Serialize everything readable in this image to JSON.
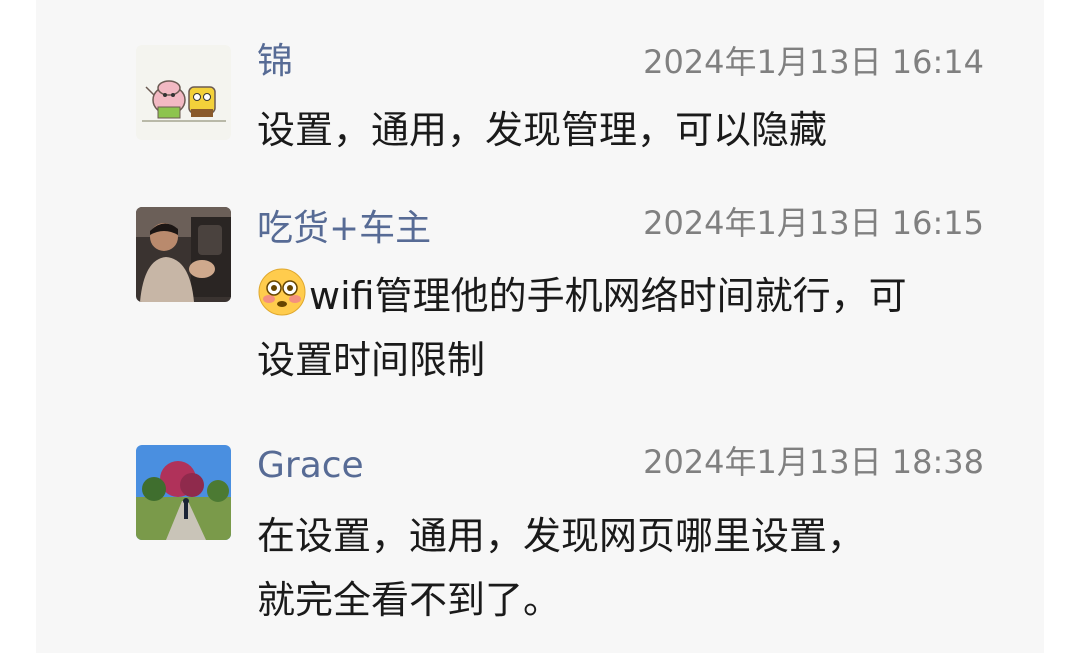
{
  "comments": [
    {
      "author": "锦",
      "time": "2024年1月13日 16:14",
      "lines": [
        "设置，通用，发现管理，可以隐藏"
      ]
    },
    {
      "author": "吃货+车主",
      "time": "2024年1月13日 16:15",
      "emoji": "flushed-face-icon",
      "lines": [
        "wifi管理他的手机网络时间就行，可",
        "设置时间限制"
      ]
    },
    {
      "author": "Grace",
      "time": "2024年1月13日 18:38",
      "lines": [
        "在设置，通用，发现网页哪里设置，",
        "就完全看不到了。"
      ]
    }
  ],
  "colors": {
    "author": "#576b95",
    "timestamp": "#808080",
    "text": "#1a1a1a",
    "background": "#f7f7f7"
  }
}
